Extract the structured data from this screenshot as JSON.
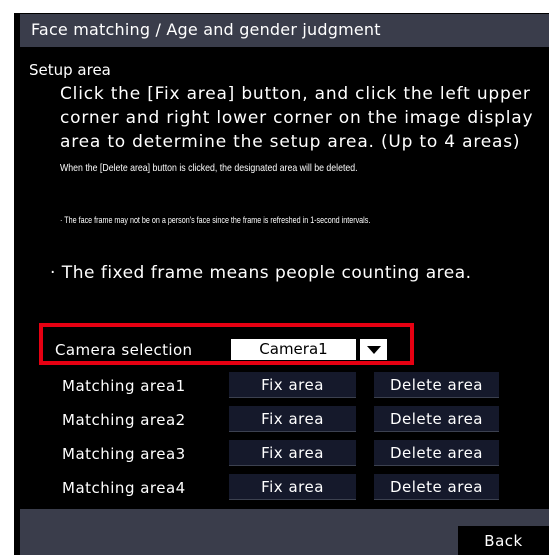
{
  "window": {
    "title": "Face matching / Age and gender judgment"
  },
  "setup": {
    "heading": "Setup area",
    "instruction_lines": [
      "Click the [Fix area] button, and click the left upper",
      "corner and right lower corner on the image display",
      "area to determine the setup area. (Up to 4 areas)"
    ],
    "delete_note": "When the [Delete area] button is clicked, the designated area will be deleted.",
    "face_frame_note": "· The face frame may not be on a person's face since the frame is refreshed in 1-second intervals.",
    "fixed_frame_note": "· The fixed frame means people counting area."
  },
  "camera_selection": {
    "label": "Camera selection",
    "selected": "Camera1",
    "highlight_color": "#e60012"
  },
  "areas": [
    {
      "label": "Matching area1",
      "fix_button": "Fix area",
      "delete_button": "Delete area"
    },
    {
      "label": "Matching area2",
      "fix_button": "Fix area",
      "delete_button": "Delete area"
    },
    {
      "label": "Matching area3",
      "fix_button": "Fix area",
      "delete_button": "Delete area"
    },
    {
      "label": "Matching area4",
      "fix_button": "Fix area",
      "delete_button": "Delete area"
    }
  ],
  "footer": {
    "back_label": "Back"
  },
  "colors": {
    "header_bg": "#3a3d4b",
    "panel_bg": "#000000",
    "button_bg": "#15192b"
  }
}
